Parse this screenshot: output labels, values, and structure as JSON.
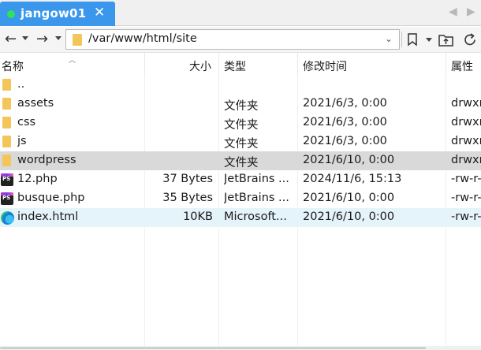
{
  "tab": {
    "label": "jangow01",
    "close": "✕",
    "status_color": "#2ee25a"
  },
  "tab_nav": {
    "prev": "◀",
    "next": "▶"
  },
  "toolbar": {
    "back": "←",
    "forward": "→",
    "address": "/var/www/html/site",
    "address_dropdown": "⌄",
    "bookmark_icon": "bookmark-icon",
    "parent_folder_icon": "parent-folder-icon",
    "refresh_icon": "refresh-icon"
  },
  "columns": {
    "name": "名称",
    "size": "大小",
    "type": "类型",
    "modified": "修改时间",
    "attributes": "属性"
  },
  "files": [
    {
      "name": "..",
      "size": "",
      "type": "",
      "modified": "",
      "attributes": "",
      "icon": "folder-icon",
      "state": "normal"
    },
    {
      "name": "assets",
      "size": "",
      "type": "文件夹",
      "modified": "2021/6/3, 0:00",
      "attributes": "drwxr",
      "icon": "folder-icon",
      "state": "normal"
    },
    {
      "name": "css",
      "size": "",
      "type": "文件夹",
      "modified": "2021/6/3, 0:00",
      "attributes": "drwxr",
      "icon": "folder-icon",
      "state": "normal"
    },
    {
      "name": "js",
      "size": "",
      "type": "文件夹",
      "modified": "2021/6/3, 0:00",
      "attributes": "drwxr",
      "icon": "folder-icon",
      "state": "normal"
    },
    {
      "name": "wordpress",
      "size": "",
      "type": "文件夹",
      "modified": "2021/6/10, 0:00",
      "attributes": "drwxr",
      "icon": "folder-icon",
      "state": "selected"
    },
    {
      "name": "12.php",
      "size": "37 Bytes",
      "type": "JetBrains ...",
      "modified": "2024/11/6, 15:13",
      "attributes": "-rw-r-",
      "icon": "phpstorm-icon",
      "state": "normal"
    },
    {
      "name": "busque.php",
      "size": "35 Bytes",
      "type": "JetBrains ...",
      "modified": "2021/6/10, 0:00",
      "attributes": "-rw-r-",
      "icon": "phpstorm-icon",
      "state": "normal"
    },
    {
      "name": "index.html",
      "size": "10KB",
      "type": "Microsoft...",
      "modified": "2021/6/10, 0:00",
      "attributes": "-rw-r-",
      "icon": "edge-icon",
      "state": "focused"
    }
  ],
  "colors": {
    "tab_active": "#3a97ec",
    "row_selected": "#d9d9d9",
    "row_focused": "#e5f3fb",
    "folder": "#f4c65a"
  }
}
